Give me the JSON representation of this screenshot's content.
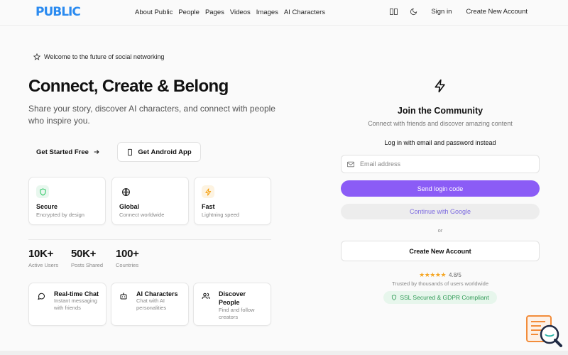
{
  "header": {
    "logo_text": "PUBLIC",
    "nav": [
      "About Public",
      "People",
      "Pages",
      "Videos",
      "Images",
      "AI Characters"
    ],
    "sign_in": "Sign in",
    "create_account": "Create New Account",
    "icons": [
      "translate-icon",
      "moon-icon"
    ]
  },
  "hero": {
    "welcome": "Welcome to the future of social networking",
    "title": "Connect, Create & Belong",
    "subtitle": "Share your story, discover AI characters, and connect with people who inspire you.",
    "get_started": "Get Started Free",
    "android": "Get Android App"
  },
  "features": [
    {
      "title": "Secure",
      "desc": "Encrypted by design",
      "icon": "shield-icon",
      "color": "#22c55e"
    },
    {
      "title": "Global",
      "desc": "Connect worldwide",
      "icon": "globe-icon",
      "color": "#111111"
    },
    {
      "title": "Fast",
      "desc": "Lightning speed",
      "icon": "bolt-icon",
      "color": "#f59e0b"
    }
  ],
  "stats": [
    {
      "value": "10K+",
      "label": "Active Users"
    },
    {
      "value": "50K+",
      "label": "Posts Shared"
    },
    {
      "value": "100+",
      "label": "Countries"
    }
  ],
  "cards": [
    {
      "title": "Real-time Chat",
      "desc": "Instant messaging with friends",
      "icon": "chat-icon"
    },
    {
      "title": "AI Characters",
      "desc": "Chat with AI personalities",
      "icon": "bot-icon"
    },
    {
      "title": "Discover People",
      "desc": "Find and follow creators",
      "icon": "users-icon"
    }
  ],
  "login": {
    "title": "Join the Community",
    "subtitle": "Connect with friends and discover amazing content",
    "mode_link": "Log in with email and password instead",
    "email_placeholder": "Email address",
    "send_code": "Send login code",
    "google": "Continue with Google",
    "or": "or",
    "create": "Create New Account",
    "stars": "★★★★★",
    "rating": "4.8/5",
    "trusted": "Trusted by thousands of users worldwide",
    "badge": "SSL Secured & GDPR Compliant"
  },
  "colors": {
    "accent": "#8b5cf6",
    "brand": "#2b8bf0",
    "success": "#2f9a55"
  }
}
